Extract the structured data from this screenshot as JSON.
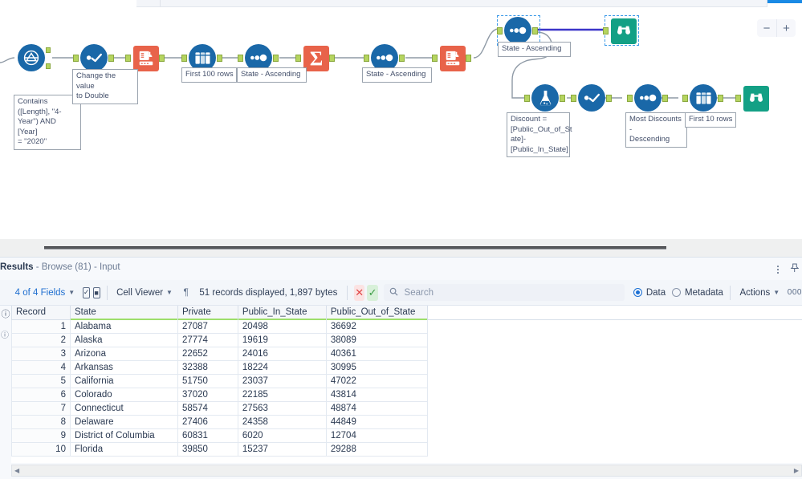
{
  "window": {
    "zoom_out_label": "−",
    "zoom_in_label": "+"
  },
  "canvas": {
    "nodes": [
      {
        "id": "filter",
        "icon": "filter-icon",
        "label": ""
      },
      {
        "id": "select",
        "icon": "select-icon",
        "label": ""
      },
      {
        "id": "formula1",
        "icon": "formula-icon",
        "label": ""
      },
      {
        "id": "sample1",
        "icon": "sample-icon",
        "label": ""
      },
      {
        "id": "sort1",
        "icon": "sort-icon",
        "label": ""
      },
      {
        "id": "summarize",
        "icon": "summarize-icon",
        "label": ""
      },
      {
        "id": "sort2",
        "icon": "sort-icon",
        "label": ""
      },
      {
        "id": "crosstab",
        "icon": "crosstab-icon",
        "label": ""
      },
      {
        "id": "sort3",
        "icon": "sort-icon",
        "label": ""
      },
      {
        "id": "browse1",
        "icon": "browse-icon",
        "label": ""
      },
      {
        "id": "formula2",
        "icon": "formula-flask-icon",
        "label": ""
      },
      {
        "id": "select2",
        "icon": "select-icon",
        "label": ""
      },
      {
        "id": "sort4",
        "icon": "sort-icon",
        "label": ""
      },
      {
        "id": "sample2",
        "icon": "sample-icon",
        "label": ""
      },
      {
        "id": "browse2",
        "icon": "browse-icon",
        "label": ""
      }
    ],
    "annotations": [
      {
        "id": "filter-anno",
        "text": "Contains\n([Length], \"4-\nYear\") AND [Year]\n= \"2020\""
      },
      {
        "id": "select-anno",
        "text": "Change the value\nto Double"
      },
      {
        "id": "sample1-anno",
        "text": "First 100 rows"
      },
      {
        "id": "sort1-anno",
        "text": "State - Ascending"
      },
      {
        "id": "sort2-anno",
        "text": "State - Ascending"
      },
      {
        "id": "sort3-anno",
        "text": "State - Ascending"
      },
      {
        "id": "formula2-anno",
        "text": "Discount =\n[Public_Out_of_St\nate]-\n[Public_In_State]"
      },
      {
        "id": "sort4-anno",
        "text": "Most Discounts -\nDescending"
      },
      {
        "id": "sample2-anno",
        "text": "First 10 rows"
      }
    ]
  },
  "results": {
    "title_main": "Results",
    "title_sub": " - Browse (81) - Input",
    "toolbar": {
      "fields_label": "4 of 4 Fields",
      "cell_viewer_label": "Cell Viewer",
      "pilcrow": "¶",
      "records_label": "51 records displayed, 1,897 bytes",
      "cancel_label": "✕",
      "confirm_label": "✓",
      "search_placeholder": "Search",
      "search_value": "",
      "data_label": "Data",
      "metadata_label": "Metadata",
      "actions_label": "Actions",
      "dots_label": "000"
    },
    "table": {
      "columns": [
        "Record",
        "State",
        "Private",
        "Public_In_State",
        "Public_Out_of_State"
      ],
      "rows": [
        {
          "record": "1",
          "state": "Alabama",
          "private": "27087",
          "public_in": "20498",
          "public_out": "36692"
        },
        {
          "record": "2",
          "state": "Alaska",
          "private": "27774",
          "public_in": "19619",
          "public_out": "38089"
        },
        {
          "record": "3",
          "state": "Arizona",
          "private": "22652",
          "public_in": "24016",
          "public_out": "40361"
        },
        {
          "record": "4",
          "state": "Arkansas",
          "private": "32388",
          "public_in": "18224",
          "public_out": "30995"
        },
        {
          "record": "5",
          "state": "California",
          "private": "51750",
          "public_in": "23037",
          "public_out": "47022"
        },
        {
          "record": "6",
          "state": "Colorado",
          "private": "37020",
          "public_in": "22185",
          "public_out": "43814"
        },
        {
          "record": "7",
          "state": "Connecticut",
          "private": "58574",
          "public_in": "27563",
          "public_out": "48874"
        },
        {
          "record": "8",
          "state": "Delaware",
          "private": "27406",
          "public_in": "24358",
          "public_out": "44849"
        },
        {
          "record": "9",
          "state": "District of Columbia",
          "private": "60831",
          "public_in": "6020",
          "public_out": "12704"
        },
        {
          "record": "10",
          "state": "Florida",
          "private": "39850",
          "public_in": "15237",
          "public_out": "29288"
        }
      ]
    }
  },
  "colors": {
    "tool_blue": "#1a68a8",
    "tool_orange": "#e8634a",
    "tool_green": "#13a085",
    "port_green": "#b5d45f",
    "selection_blue": "#3c9ae8",
    "header_underline": "#9ede6b"
  }
}
